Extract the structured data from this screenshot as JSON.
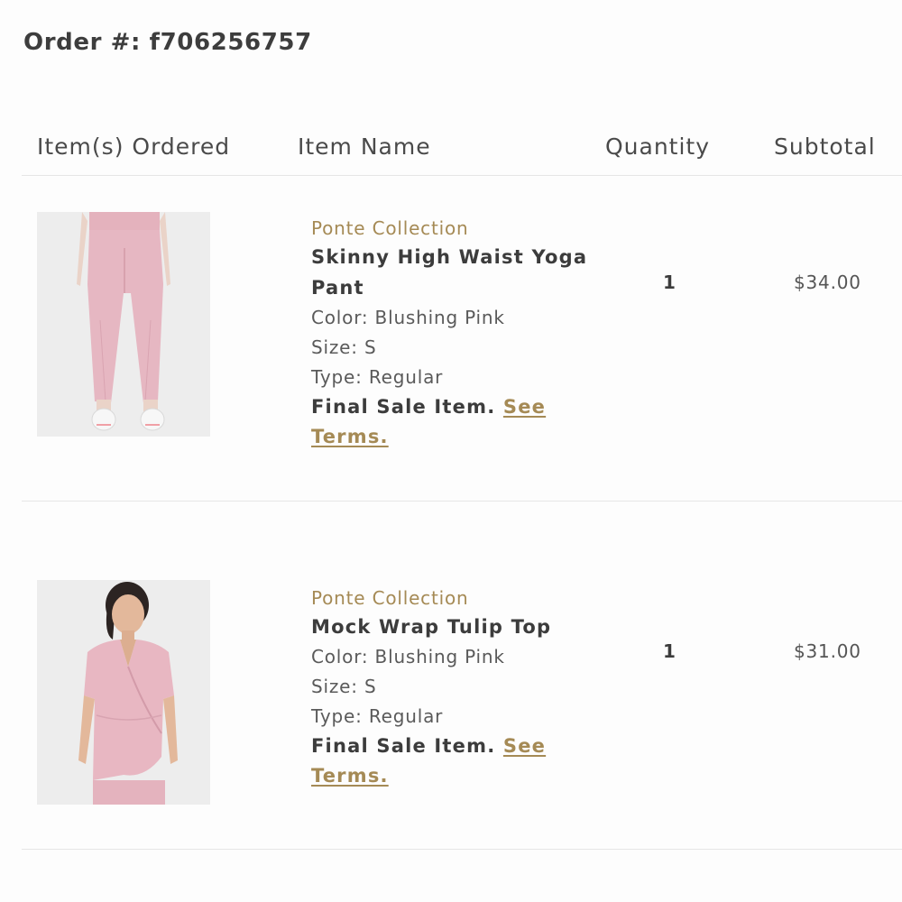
{
  "order": {
    "title": "Order #: f706256757"
  },
  "table": {
    "headers": {
      "items": "Item(s) Ordered",
      "name": "Item Name",
      "quantity": "Quantity",
      "subtotal": "Subtotal"
    }
  },
  "items": [
    {
      "collection": "Ponte Collection",
      "name": "Skinny High Waist Yoga Pant",
      "color": "Color: Blushing Pink",
      "size": "Size: S",
      "type": "Type: Regular",
      "final_sale": "Final Sale Item.",
      "terms_link": "See Terms.",
      "quantity": "1",
      "subtotal": "$34.00",
      "image_icon": "pink-yoga-pant-photo"
    },
    {
      "collection": "Ponte Collection",
      "name": "Mock Wrap Tulip Top",
      "color": "Color: Blushing Pink",
      "size": "Size: S",
      "type": "Type: Regular",
      "final_sale": "Final Sale Item.",
      "terms_link": "See Terms.",
      "quantity": "1",
      "subtotal": "$31.00",
      "image_icon": "pink-wrap-top-photo"
    }
  ],
  "colors": {
    "accent_gold": "#a58a55",
    "product_pink": "#e7b6c1",
    "divider": "#e6e6e6"
  }
}
